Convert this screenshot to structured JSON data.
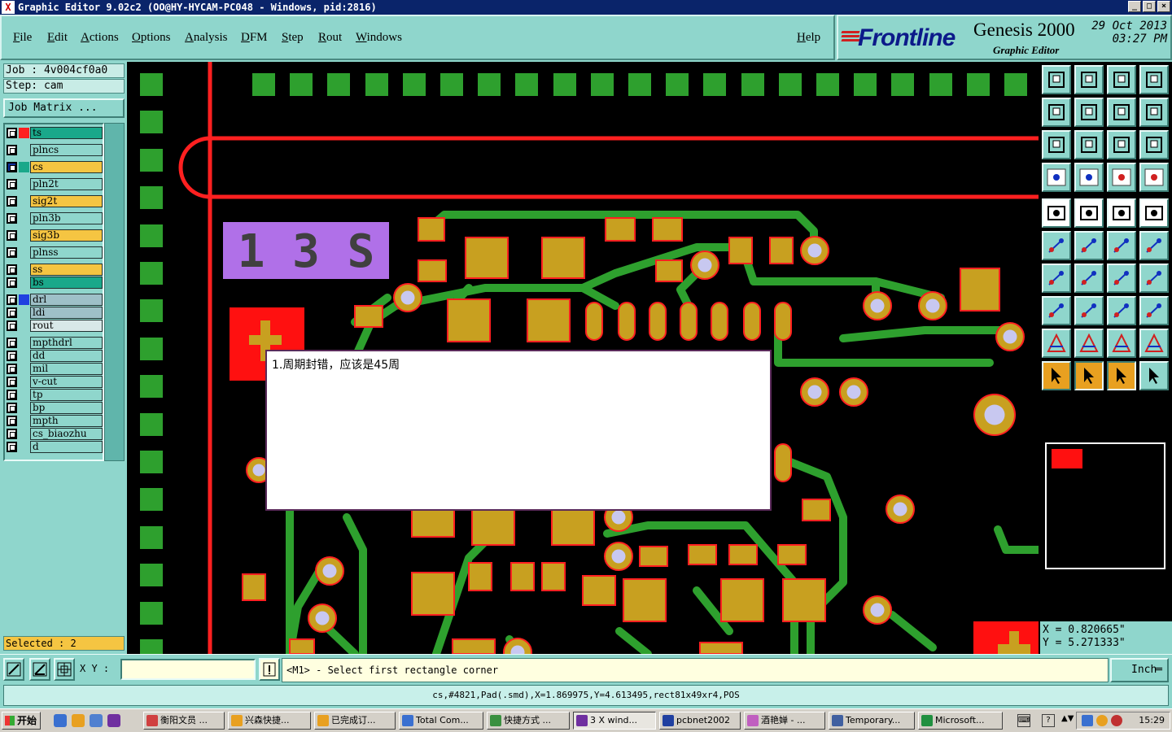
{
  "window": {
    "title": "Graphic Editor 9.02c2 (OO@HY-HYCAM-PC048 - Windows, pid:2816)"
  },
  "menu": {
    "items": [
      "File",
      "Edit",
      "Actions",
      "Options",
      "Analysis",
      "DFM",
      "Step",
      "Rout",
      "Windows"
    ],
    "help": "Help"
  },
  "brand": {
    "logo": "Frontline",
    "product": "Genesis 2000",
    "subtitle": "Graphic Editor",
    "date": "29 Oct 2013",
    "time": "03:27 PM"
  },
  "job": {
    "job_line": "Job : 4v004cf0a0",
    "step_line": "Step: cam",
    "matrix_button": "Job Matrix ..."
  },
  "layers": [
    {
      "name": "ts",
      "bg": "#1aa88a",
      "swatch": "#ff2020"
    },
    {
      "name": "plncs",
      "bg": "#8fd6cc",
      "swatch": ""
    },
    {
      "name": "cs",
      "bg": "#f5c542",
      "swatch": "#1aa88a",
      "active": true
    },
    {
      "name": "pln2t",
      "bg": "#8fd6cc",
      "swatch": ""
    },
    {
      "name": "sig2t",
      "bg": "#f5c542",
      "swatch": ""
    },
    {
      "name": "pln3b",
      "bg": "#8fd6cc",
      "swatch": ""
    },
    {
      "name": "sig3b",
      "bg": "#f5c542",
      "swatch": ""
    },
    {
      "name": "plnss",
      "bg": "#8fd6cc",
      "swatch": ""
    },
    {
      "name": "ss",
      "bg": "#f5c542",
      "swatch": ""
    },
    {
      "name": "bs",
      "bg": "#1aa88a",
      "swatch": ""
    },
    {
      "name": "drl",
      "bg": "#9ec0c8",
      "swatch": "#2040e0"
    },
    {
      "name": "ldi",
      "bg": "#9ec0c8",
      "swatch": ""
    },
    {
      "name": "rout",
      "bg": "#d8e8e8",
      "swatch": ""
    },
    {
      "name": "mpthdrl",
      "bg": "#8fd6cc",
      "swatch": ""
    },
    {
      "name": "dd",
      "bg": "#8fd6cc",
      "swatch": ""
    },
    {
      "name": "mil",
      "bg": "#8fd6cc",
      "swatch": ""
    },
    {
      "name": "v-cut",
      "bg": "#8fd6cc",
      "swatch": ""
    },
    {
      "name": "tp",
      "bg": "#8fd6cc",
      "swatch": ""
    },
    {
      "name": "bp",
      "bg": "#8fd6cc",
      "swatch": ""
    },
    {
      "name": "mpth",
      "bg": "#8fd6cc",
      "swatch": ""
    },
    {
      "name": "cs_biaozhu",
      "bg": "#8fd6cc",
      "swatch": ""
    },
    {
      "name": "d",
      "bg": "#8fd6cc",
      "swatch": ""
    }
  ],
  "selected": "Selected : 2",
  "note": "1.周期封错，应该是45周",
  "silkscreen_text": "1 3 S",
  "coordinates": {
    "x": "X = 0.820665\"",
    "y": "Y = 5.271333\""
  },
  "command": {
    "xy_label": "X Y :",
    "xy_value": "",
    "prompt": "<M1> - Select first rectangle corner",
    "units": "Inch"
  },
  "status": "cs,#4821,Pad(.smd),X=1.869975,Y=4.613495,rect81x49xr4,POS",
  "taskbar": {
    "start": "开始",
    "tasks": [
      "衡阳文员 ...",
      "兴森快捷...",
      "已完成订...",
      "Total Com...",
      "快捷方式 ...",
      "3 X wind...",
      "pcbnet2002",
      "酒艳婵 - ...",
      "Temporary...",
      "Microsoft..."
    ],
    "active_task": 5,
    "clock": "15:29"
  },
  "colors": {
    "panel": "#8fd6cc",
    "trace": "#2ea02e",
    "pad": "#c8a020",
    "pad_outline": "#ff2020",
    "via_hole": "#c8c8f0",
    "silkscreen_box": "#b070e8"
  }
}
